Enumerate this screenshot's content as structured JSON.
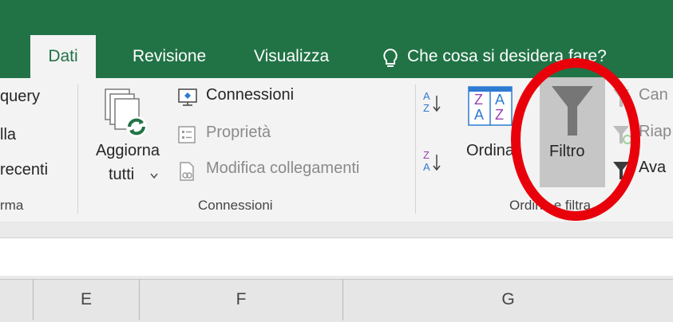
{
  "tabs": [
    {
      "label": "Dati",
      "active": true
    },
    {
      "label": "Revisione"
    },
    {
      "label": "Visualizza"
    }
  ],
  "tell_me": {
    "text": "Che cosa si desidera fare?",
    "icon": "lightbulb-icon"
  },
  "groups": {
    "recupera": {
      "items": [
        "query",
        "lla",
        "recenti"
      ],
      "label": "rma"
    },
    "connessioni": {
      "refresh_all_line1": "Aggiorna",
      "refresh_all_line2": "tutti",
      "connections": "Connessioni",
      "properties": "Proprietà",
      "edit_links": "Modifica collegamenti",
      "label": "Connessioni"
    },
    "ordina_filtra": {
      "sort_label": "Ordina",
      "filter_label": "Filtro",
      "clear_label": "Can",
      "reapply_label": "Riap",
      "advanced_label": "Ava",
      "label": "Ordina e filtra",
      "sort_az_letters": [
        "A",
        "Z"
      ],
      "sort_za_letters": [
        "Z",
        "A"
      ],
      "sort_dialog_letters": [
        "Z",
        "A",
        "A",
        "Z"
      ]
    }
  },
  "columns": [
    "E",
    "F",
    "G"
  ],
  "colors": {
    "brand": "#217346",
    "highlight_circle": "#e8000b",
    "filter_active_bg": "#c6c6c6"
  }
}
